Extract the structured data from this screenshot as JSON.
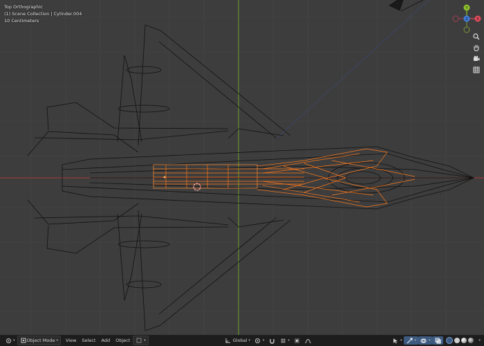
{
  "viewport": {
    "view_name": "Top Orthographic",
    "collection_line": "(1) Scene Collection | Cylinder.004",
    "scale_line": "10 Centimeters"
  },
  "gizmo": {
    "x_label": "X",
    "y_label": "Y",
    "z_label": "Z",
    "colors": {
      "x": "#e04a5b",
      "y": "#8ec12b",
      "z": "#3f7ee0"
    }
  },
  "nav_tools": [
    "zoom-icon",
    "hand-pan-icon",
    "camera-icon",
    "grid-icon"
  ],
  "header": {
    "mode": "Object Mode",
    "menus": [
      "View",
      "Select",
      "Add",
      "Object"
    ],
    "transform_orientation": "Global"
  },
  "colors": {
    "background": "#3d3d3d",
    "wire": "#111111",
    "selected": "#ff7a1a",
    "x_axis": "#b03a3a",
    "y_axis": "#6f9a2a"
  }
}
